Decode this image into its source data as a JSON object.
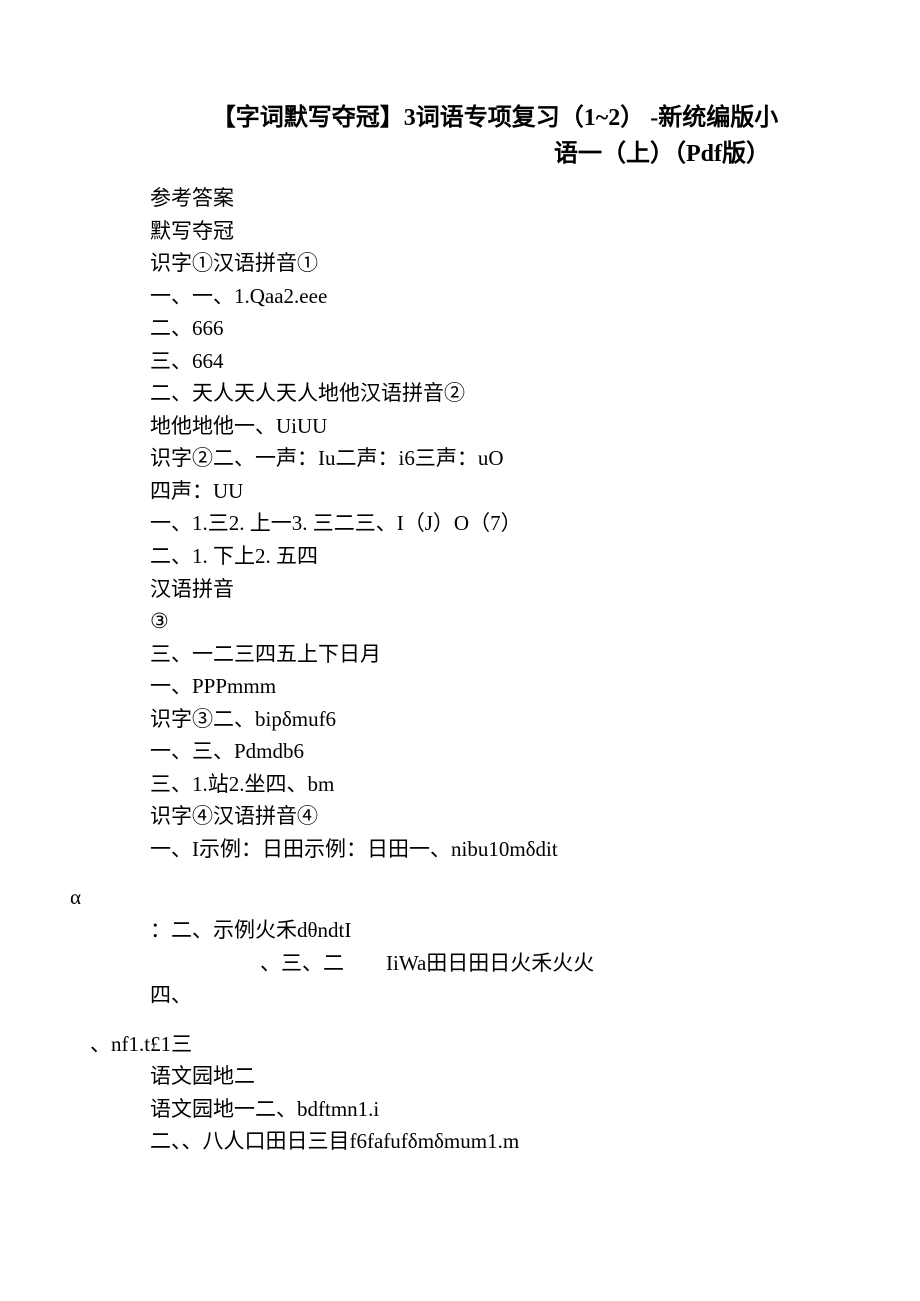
{
  "title": {
    "line1": "【字词默写夺冠】3词语专项复习（1~2） -新统编版小",
    "line2": "语一（上）（Pdf版）"
  },
  "lines": [
    {
      "cls": "",
      "text": "参考答案"
    },
    {
      "cls": "",
      "text": "默写夺冠"
    },
    {
      "cls": "",
      "text": "识字①汉语拼音①"
    },
    {
      "cls": "",
      "text": "一、一、1.Qaa2.eee"
    },
    {
      "cls": "",
      "text": "二、666"
    },
    {
      "cls": "",
      "text": "三、664"
    },
    {
      "cls": "",
      "text": "二、天人天人天人地他汉语拼音②"
    },
    {
      "cls": "",
      "text": "地他地他一、UiUU"
    },
    {
      "cls": "",
      "text": "识字②二、一声：Iu二声：i6三声：uO"
    },
    {
      "cls": "",
      "text": "四声：UU"
    },
    {
      "cls": "",
      "text": "一、1.三2. 上一3. 三二三、I（J）O（7）"
    },
    {
      "cls": "",
      "text": "二、1. 下上2. 五四"
    },
    {
      "cls": "",
      "text": "汉语拼音"
    },
    {
      "cls": "",
      "text": "③"
    },
    {
      "cls": "",
      "text": "三、一二三四五上下日月"
    },
    {
      "cls": "",
      "text": "一、PPPmmm"
    },
    {
      "cls": "",
      "text": "识字③二、bipδmuf6"
    },
    {
      "cls": "",
      "text": "一、三、Pdmdb6"
    },
    {
      "cls": "",
      "text": "三、1.站2.坐四、bm"
    },
    {
      "cls": "",
      "text": "识字④汉语拼音④"
    },
    {
      "cls": "",
      "text": "一、I示例：日田示例：日田一、nibu10mδdit"
    },
    {
      "cls": "blank",
      "text": ""
    },
    {
      "cls": "outdent1",
      "text": "α"
    },
    {
      "cls": "",
      "text": "：二、示例火禾dθndtI"
    },
    {
      "cls": "indent1",
      "text": "、三、二        IiWa田日田日火禾火火"
    },
    {
      "cls": "",
      "text": "四、"
    },
    {
      "cls": "blank",
      "text": ""
    },
    {
      "cls": "outdent2",
      "text": "、nf1.t£1三"
    },
    {
      "cls": "",
      "text": "语文园地二"
    },
    {
      "cls": "",
      "text": "语文园地一二、bdftmn1.i"
    },
    {
      "cls": "",
      "text": "二、、八人口田日三目f6fafufδmδmum1.m"
    }
  ]
}
